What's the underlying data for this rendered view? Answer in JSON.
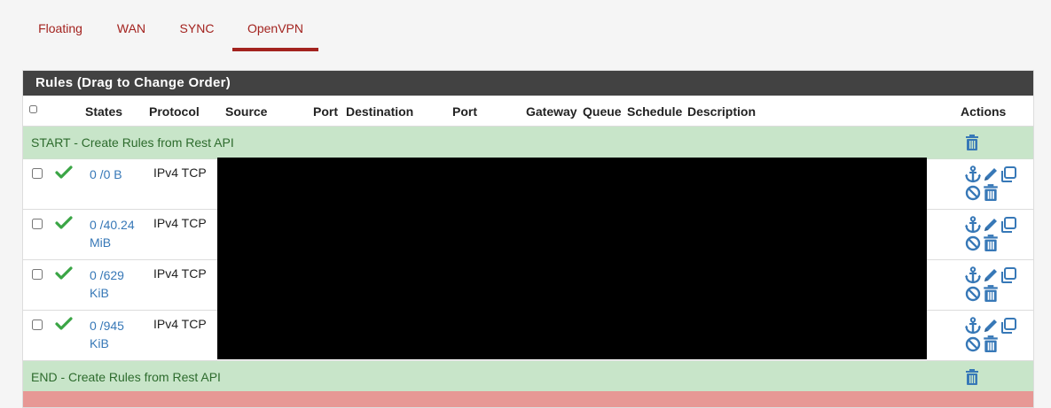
{
  "tabs": [
    {
      "label": "Floating"
    },
    {
      "label": "WAN"
    },
    {
      "label": "SYNC"
    },
    {
      "label": "OpenVPN",
      "active": true
    }
  ],
  "panel": {
    "title": "Rules (Drag to Change Order)"
  },
  "columns": {
    "states": "States",
    "protocol": "Protocol",
    "source": "Source",
    "port": "Port",
    "destination": "Destination",
    "port2": "Port",
    "gateway": "Gateway",
    "queue": "Queue",
    "schedule": "Schedule",
    "description": "Description",
    "actions": "Actions"
  },
  "separators": {
    "start": "START - Create Rules from Rest API",
    "end": "END - Create Rules from Rest API"
  },
  "rows": [
    {
      "states_line1": "0 /0 B",
      "states_line2": "",
      "protocol": "IPv4 TCP"
    },
    {
      "states_line1": "0 /40.24",
      "states_line2": "MiB",
      "protocol": "IPv4 TCP"
    },
    {
      "states_line1": "0 /629",
      "states_line2": "KiB",
      "protocol": "IPv4 TCP"
    },
    {
      "states_line1": "0 /945",
      "states_line2": "KiB",
      "protocol": "IPv4 TCP"
    }
  ],
  "icons": {
    "status": "check-icon",
    "anchor": "anchor-icon",
    "edit": "pencil-icon",
    "copy": "copy-icon",
    "disable": "ban-icon",
    "delete": "trash-icon"
  },
  "colors": {
    "accent": "#a3231f",
    "heading_bg": "#424242",
    "separator_bg": "#c8e5c9",
    "link": "#3778b7",
    "check": "#3aa545"
  }
}
